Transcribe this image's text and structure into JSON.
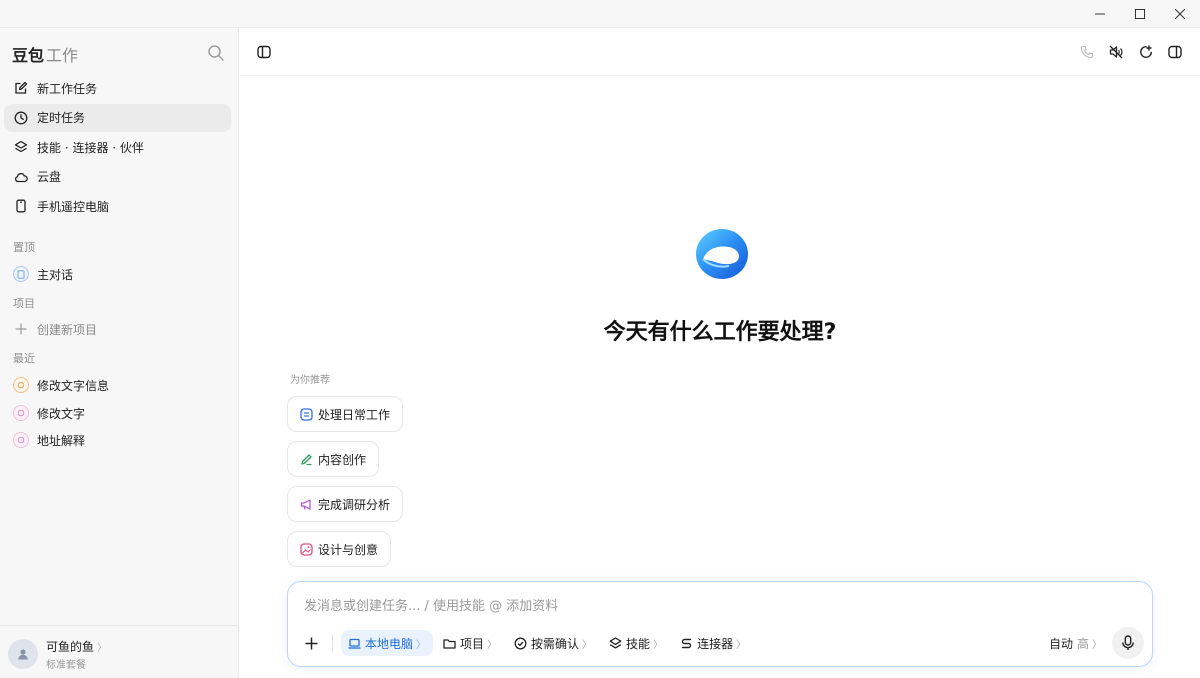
{
  "window": {
    "minimize_icon": "minimize-icon",
    "maximize_icon": "maximize-icon",
    "close_icon": "close-icon"
  },
  "sidebar": {
    "brand": "豆包",
    "brand_suffix": "工作",
    "nav": [
      {
        "label": "新工作任务",
        "icon": "edit-icon"
      },
      {
        "label": "定时任务",
        "icon": "clock-icon",
        "active": true
      },
      {
        "label": "技能 · 连接器 · 伙伴",
        "icon": "layers-icon"
      },
      {
        "label": "云盘",
        "icon": "cloud-icon"
      },
      {
        "label": "手机遥控电脑",
        "icon": "phone-icon"
      }
    ],
    "pinned_label": "置顶",
    "pinned": [
      {
        "label": "主对话"
      }
    ],
    "projects_label": "项目",
    "new_project": "创建新项目",
    "recent_label": "最近",
    "recent": [
      {
        "label": "修改文字信息"
      },
      {
        "label": "修改文字"
      },
      {
        "label": "地址解释"
      }
    ],
    "user": {
      "name": "可鱼的鱼",
      "plan": "标准套餐"
    }
  },
  "main": {
    "headline": "今天有什么工作要处理?",
    "recommend_label": "为你推荐",
    "suggestions": [
      {
        "label": "处理日常工作",
        "icon": "daily-work-icon"
      },
      {
        "label": "内容创作",
        "icon": "pen-icon"
      },
      {
        "label": "完成调研分析",
        "icon": "megaphone-icon"
      },
      {
        "label": "设计与创意",
        "icon": "image-icon"
      }
    ],
    "composer": {
      "placeholder": "发消息或创建任务... / 使用技能 @ 添加资料",
      "tools": [
        {
          "label": "本地电脑",
          "icon": "laptop-icon",
          "active": true
        },
        {
          "label": "项目",
          "icon": "folder-icon"
        },
        {
          "label": "按需确认",
          "icon": "check-circle-icon"
        },
        {
          "label": "技能",
          "icon": "layers-icon"
        },
        {
          "label": "连接器",
          "icon": "connector-icon"
        }
      ],
      "mode": "自动",
      "mode_level": "高"
    }
  },
  "colors": {
    "accent": "#1f6fd8",
    "active_bg": "#eaf2fd",
    "sidebar_bg": "#f7f7f7"
  }
}
